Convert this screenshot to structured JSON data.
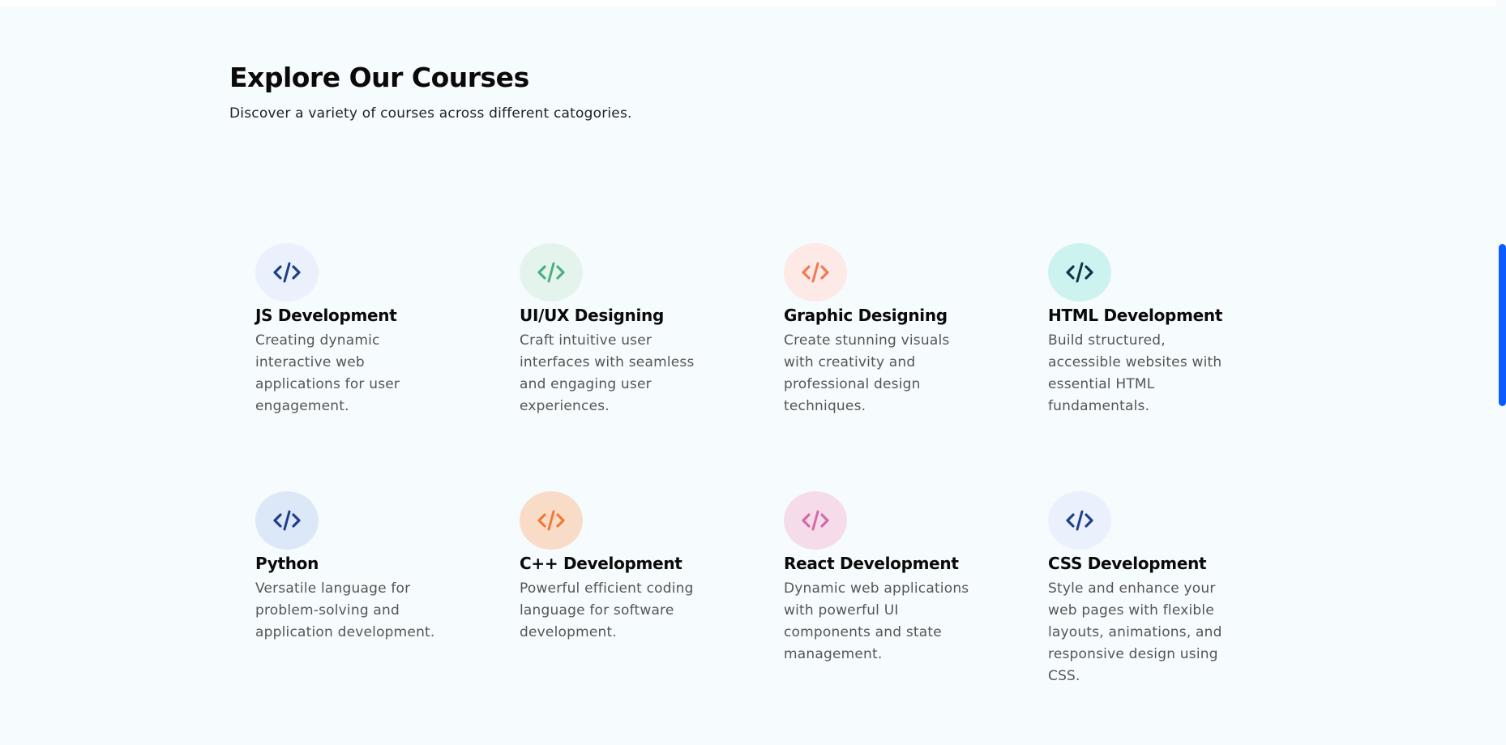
{
  "section": {
    "title": "Explore Our Courses",
    "subtitle": "Discover a variety of courses across different catogories."
  },
  "courses": [
    {
      "title": "JS Development",
      "description": "Creating dynamic interactive web applications for user engagement.",
      "icon": "code-icon",
      "bg": "#eaf1fd",
      "fg": "#1e3f8a"
    },
    {
      "title": "UI/UX Designing",
      "description": "Craft intuitive user interfaces with seamless and engaging user experiences.",
      "icon": "code-icon",
      "bg": "#e4f4ec",
      "fg": "#4caf80"
    },
    {
      "title": "Graphic Designing",
      "description": "Create stunning visuals with creativity and professional design techniques.",
      "icon": "code-icon",
      "bg": "#fde9e6",
      "fg": "#f07a55"
    },
    {
      "title": "HTML Development",
      "description": "Build structured, accessible websites with essential HTML fundamentals.",
      "icon": "code-icon",
      "bg": "#cdf3f0",
      "fg": "#12324a"
    },
    {
      "title": "Python",
      "description": "Versatile language for problem-solving and application development.",
      "icon": "code-icon",
      "bg": "#dce8f8",
      "fg": "#1e3f8a"
    },
    {
      "title": "C++ Development",
      "description": "Powerful efficient coding language for software development.",
      "icon": "code-icon",
      "bg": "#f8dcc8",
      "fg": "#f07a35"
    },
    {
      "title": "React Development",
      "description": "Dynamic web applications with powerful UI components and state management.",
      "icon": "code-icon",
      "bg": "#f6dcea",
      "fg": "#d46aa8"
    },
    {
      "title": "CSS Development",
      "description": "Style and enhance your web pages with flexible layouts, animations, and responsive design using CSS.",
      "icon": "code-icon",
      "bg": "#eaf1fd",
      "fg": "#1e3f8a"
    }
  ]
}
